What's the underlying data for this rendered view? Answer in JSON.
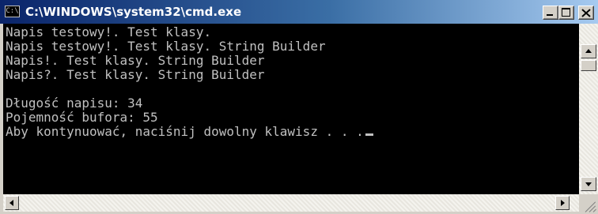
{
  "window": {
    "title": "C:\\WINDOWS\\system32\\cmd.exe",
    "icon": "console-icon",
    "icon_glyph": "C:\\"
  },
  "console": {
    "lines": [
      "Napis testowy!. Test klasy.",
      "Napis testowy!. Test klasy. String Builder",
      "Napis!. Test klasy. String Builder",
      "Napis?. Test klasy. String Builder",
      "",
      "Długość napisu: 34",
      "Pojemność bufora: 55",
      "Aby kontynuować, naciśnij dowolny klawisz . . ."
    ]
  },
  "colors": {
    "console_bg": "#000000",
    "console_text": "#c0c0c0",
    "title_start": "#0a246a",
    "title_end": "#a6caf0"
  }
}
